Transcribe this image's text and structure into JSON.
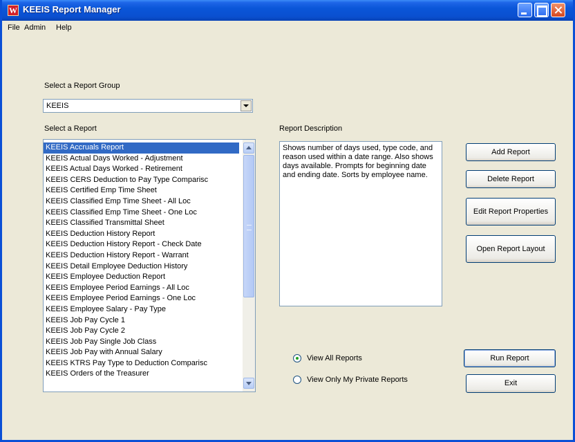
{
  "window": {
    "title": "KEEIS Report Manager"
  },
  "menu": {
    "items": [
      "File",
      "Admin",
      "Help"
    ]
  },
  "report_group": {
    "label": "Select a Report Group",
    "value": "KEEIS"
  },
  "report_list": {
    "label": "Select a Report",
    "selected_index": 0,
    "items": [
      "KEEIS Accruals Report",
      "KEEIS Actual Days Worked - Adjustment",
      "KEEIS Actual Days Worked - Retirement",
      "KEEIS CERS Deduction to Pay Type Comparisc",
      "KEEIS Certified Emp Time Sheet",
      "KEEIS Classified Emp Time Sheet - All Loc",
      "KEEIS Classified Emp Time Sheet - One Loc",
      "KEEIS Classified Transmittal Sheet",
      "KEEIS Deduction History Report",
      "KEEIS Deduction History Report - Check Date",
      "KEEIS Deduction History Report - Warrant",
      "KEEIS Detail Employee Deduction History",
      "KEEIS Employee Deduction Report",
      "KEEIS Employee Period Earnings - All Loc",
      "KEEIS Employee Period Earnings - One Loc",
      "KEEIS Employee Salary - Pay Type",
      "KEEIS Job Pay Cycle 1",
      "KEEIS Job Pay Cycle 2",
      "KEEIS Job Pay Single Job Class",
      "KEEIS Job Pay with Annual Salary",
      "KEEIS KTRS Pay Type to Deduction Comparisc",
      "KEEIS Orders of the Treasurer"
    ]
  },
  "report_description": {
    "label": "Report Description",
    "text": "Shows number of days used, type code, and reason used within a date range.  Also shows days available.  Prompts for beginning date and ending date.  Sorts by employee name."
  },
  "buttons": {
    "add": "Add Report",
    "delete": "Delete Report",
    "edit": "Edit Report Properties",
    "open": "Open Report Layout",
    "run": "Run Report",
    "exit": "Exit"
  },
  "view_options": {
    "selected": "all",
    "all_label": "View All Reports",
    "private_label": "View Only My Private Reports"
  },
  "colors": {
    "titlebar": "#0a56d8",
    "selection": "#316ac5",
    "window_bg": "#ece9d8"
  }
}
